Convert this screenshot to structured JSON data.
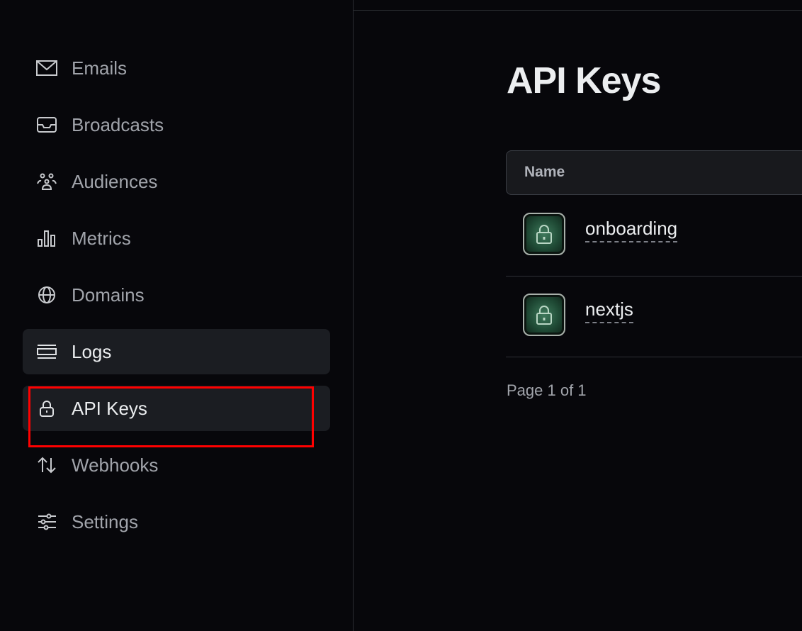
{
  "sidebar": {
    "items": [
      {
        "label": "Emails",
        "icon": "mail-icon",
        "active": false
      },
      {
        "label": "Broadcasts",
        "icon": "inbox-icon",
        "active": false
      },
      {
        "label": "Audiences",
        "icon": "users-icon",
        "active": false
      },
      {
        "label": "Metrics",
        "icon": "bar-chart-icon",
        "active": false
      },
      {
        "label": "Domains",
        "icon": "globe-icon",
        "active": false
      },
      {
        "label": "Logs",
        "icon": "logs-icon",
        "active": true
      },
      {
        "label": "API Keys",
        "icon": "lock-icon",
        "active": true
      },
      {
        "label": "Webhooks",
        "icon": "arrows-up-down-icon",
        "active": false
      },
      {
        "label": "Settings",
        "icon": "sliders-icon",
        "active": false
      }
    ]
  },
  "main": {
    "title": "API Keys",
    "table": {
      "columns": [
        "Name"
      ],
      "rows": [
        {
          "name": "onboarding",
          "icon": "lock-icon"
        },
        {
          "name": "nextjs",
          "icon": "lock-icon"
        }
      ]
    },
    "pagination": "Page 1 of 1"
  },
  "colors": {
    "background": "#07070b",
    "active_item": "#1b1d22",
    "highlight": "#ff0000",
    "key_tile": "#2f6a4c"
  }
}
